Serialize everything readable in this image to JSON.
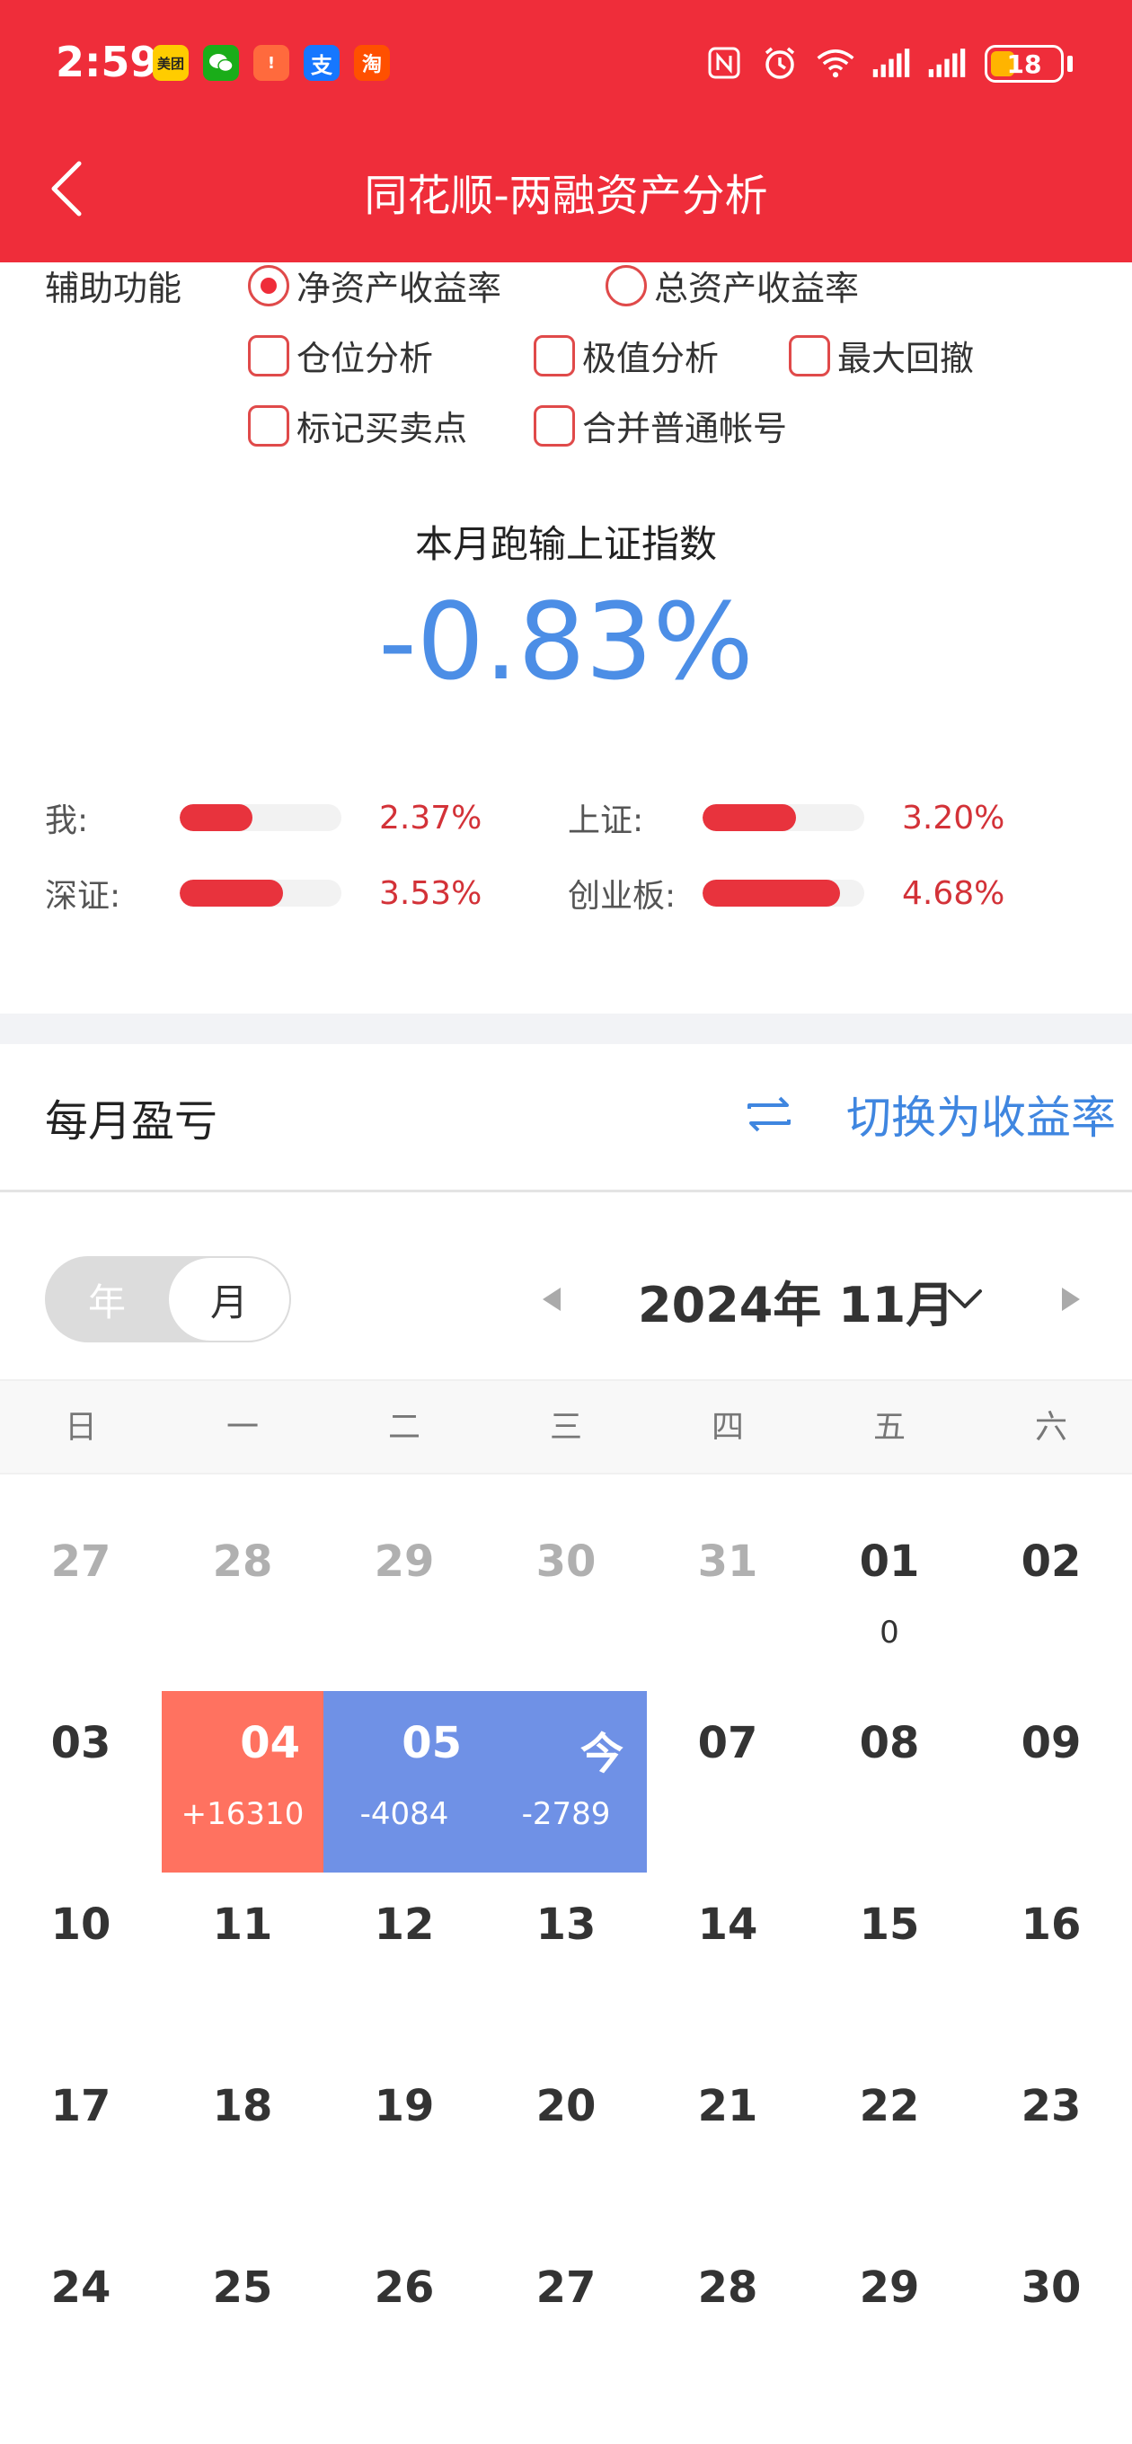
{
  "status_bar": {
    "time": "2:59",
    "apps": [
      {
        "icon": "meituan-icon",
        "label": "美团",
        "color": "#ffcc00"
      },
      {
        "icon": "wechat-icon",
        "label": "",
        "color": "#1aad19"
      },
      {
        "icon": "notice-icon",
        "label": "!",
        "color": "#ff6a3d"
      },
      {
        "icon": "alipay-icon",
        "label": "支",
        "color": "#1677ff"
      },
      {
        "icon": "taobao-icon",
        "label": "淘",
        "color": "#ff5000"
      }
    ],
    "battery": "18"
  },
  "header": {
    "title": "同花顺-两融资产分析"
  },
  "options": {
    "label": "辅助功能",
    "net_asset_return": "净资产收益率",
    "total_asset_return": "总资产收益率",
    "position_analysis": "仓位分析",
    "extreme_analysis": "极值分析",
    "max_drawdown": "最大回撤",
    "mark_trades": "标记买卖点",
    "merge_normal_account": "合并普通帐号"
  },
  "comparison": {
    "title": "本月跑输上证指数",
    "value": "-0.83%",
    "rows": [
      {
        "name": "我:",
        "value": "2.37%",
        "fraction": 0.45
      },
      {
        "name": "上证:",
        "value": "3.20%",
        "fraction": 0.58
      },
      {
        "name": "深证:",
        "value": "3.53%",
        "fraction": 0.64
      },
      {
        "name": "创业板:",
        "value": "4.68%",
        "fraction": 0.85
      }
    ]
  },
  "monthly": {
    "title": "每月盈亏",
    "switch_label": "切换为收益率",
    "segment_year": "年",
    "segment_month": "月",
    "current_month": "2024年 11月",
    "weekdays": [
      "日",
      "一",
      "二",
      "三",
      "四",
      "五",
      "六"
    ],
    "weeks": [
      [
        {
          "day": "27",
          "pnl": "",
          "type": "other"
        },
        {
          "day": "28",
          "pnl": "",
          "type": "other"
        },
        {
          "day": "29",
          "pnl": "",
          "type": "other"
        },
        {
          "day": "30",
          "pnl": "",
          "type": "other"
        },
        {
          "day": "31",
          "pnl": "",
          "type": "other"
        },
        {
          "day": "01",
          "pnl": "0",
          "type": "normal"
        },
        {
          "day": "02",
          "pnl": "",
          "type": "normal"
        }
      ],
      [
        {
          "day": "03",
          "pnl": "",
          "type": "normal"
        },
        {
          "day": "04",
          "pnl": "+16310",
          "type": "up"
        },
        {
          "day": "05",
          "pnl": "-4084",
          "type": "down"
        },
        {
          "day": "今",
          "pnl": "-2789",
          "type": "down"
        },
        {
          "day": "07",
          "pnl": "",
          "type": "normal"
        },
        {
          "day": "08",
          "pnl": "",
          "type": "normal"
        },
        {
          "day": "09",
          "pnl": "",
          "type": "normal"
        }
      ],
      [
        {
          "day": "10",
          "pnl": "",
          "type": "normal"
        },
        {
          "day": "11",
          "pnl": "",
          "type": "normal"
        },
        {
          "day": "12",
          "pnl": "",
          "type": "normal"
        },
        {
          "day": "13",
          "pnl": "",
          "type": "normal"
        },
        {
          "day": "14",
          "pnl": "",
          "type": "normal"
        },
        {
          "day": "15",
          "pnl": "",
          "type": "normal"
        },
        {
          "day": "16",
          "pnl": "",
          "type": "normal"
        }
      ],
      [
        {
          "day": "17",
          "pnl": "",
          "type": "normal"
        },
        {
          "day": "18",
          "pnl": "",
          "type": "normal"
        },
        {
          "day": "19",
          "pnl": "",
          "type": "normal"
        },
        {
          "day": "20",
          "pnl": "",
          "type": "normal"
        },
        {
          "day": "21",
          "pnl": "",
          "type": "normal"
        },
        {
          "day": "22",
          "pnl": "",
          "type": "normal"
        },
        {
          "day": "23",
          "pnl": "",
          "type": "normal"
        }
      ],
      [
        {
          "day": "24",
          "pnl": "",
          "type": "normal"
        },
        {
          "day": "25",
          "pnl": "",
          "type": "normal"
        },
        {
          "day": "26",
          "pnl": "",
          "type": "normal"
        },
        {
          "day": "27",
          "pnl": "",
          "type": "normal"
        },
        {
          "day": "28",
          "pnl": "",
          "type": "normal"
        },
        {
          "day": "29",
          "pnl": "",
          "type": "normal"
        },
        {
          "day": "30",
          "pnl": "",
          "type": "normal"
        }
      ]
    ]
  }
}
